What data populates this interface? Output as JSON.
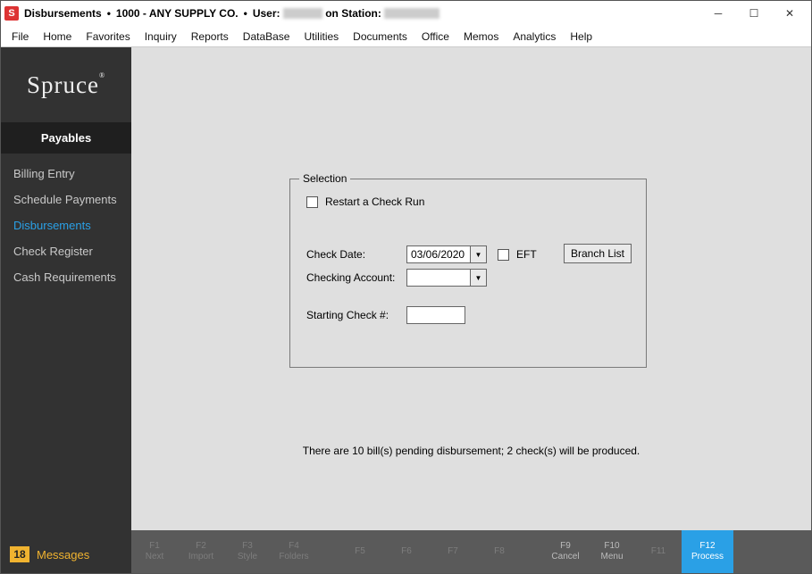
{
  "title": {
    "module": "Disbursements",
    "company": "1000 - ANY SUPPLY CO.",
    "user_prefix": "User:",
    "station_prefix": "on Station:"
  },
  "menu": [
    "File",
    "Home",
    "Favorites",
    "Inquiry",
    "Reports",
    "DataBase",
    "Utilities",
    "Documents",
    "Office",
    "Memos",
    "Analytics",
    "Help"
  ],
  "sidebar": {
    "logo": "Spruce",
    "section": "Payables",
    "items": [
      "Billing Entry",
      "Schedule Payments",
      "Disbursements",
      "Check Register",
      "Cash Requirements"
    ],
    "active_index": 2,
    "messages_count": "18",
    "messages_label": "Messages"
  },
  "selection": {
    "legend": "Selection",
    "restart_label": "Restart a Check Run",
    "check_date_label": "Check Date:",
    "check_date_value": "03/06/2020",
    "eft_label": "EFT",
    "branch_button": "Branch List",
    "checking_account_label": "Checking Account:",
    "checking_account_value": "",
    "starting_check_label": "Starting Check #:",
    "starting_check_value": ""
  },
  "status": "There are 10 bill(s) pending disbursement; 2 check(s) will be produced.",
  "fkeys": {
    "f1": "Next",
    "f2": "Import",
    "f3": "Style",
    "f4": "Folders",
    "f5": "",
    "f6": "",
    "f7": "",
    "f8": "",
    "f9": "Cancel",
    "f10": "Menu",
    "f11": "",
    "f12": "Process"
  }
}
